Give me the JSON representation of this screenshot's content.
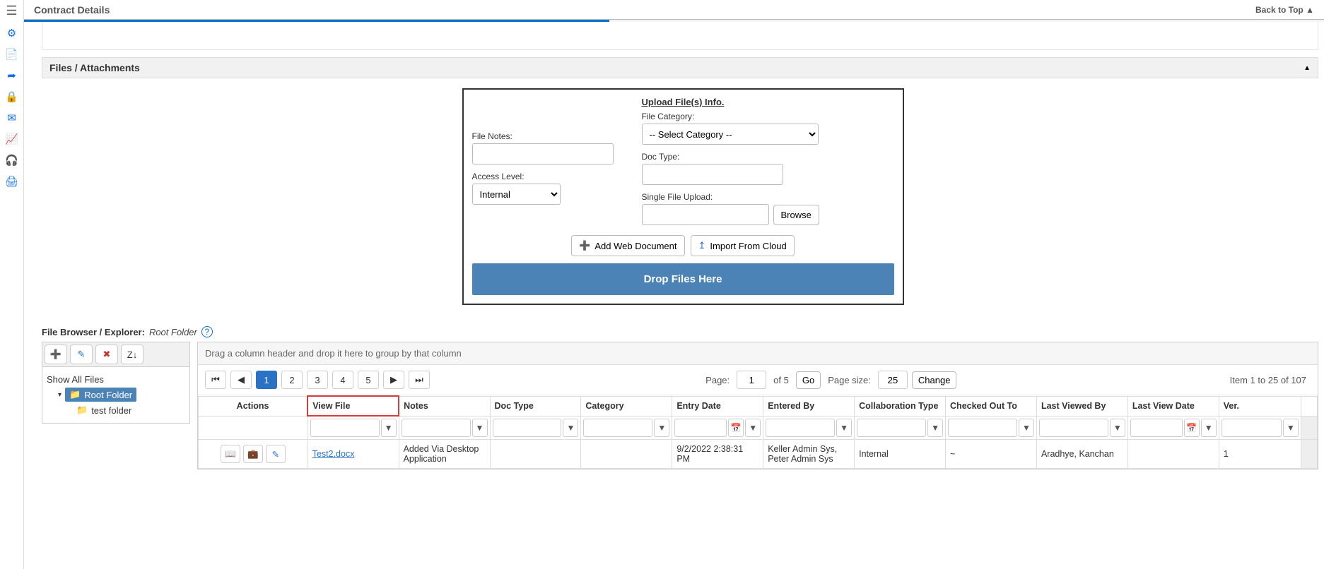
{
  "header": {
    "title": "Contract Details",
    "back_to_top": "Back to Top"
  },
  "section": {
    "files_attachments": "Files / Attachments"
  },
  "upload": {
    "title": "Upload File(s) Info.",
    "file_notes_label": "File Notes:",
    "access_level_label": "Access Level:",
    "access_level_value": "Internal",
    "file_category_label": "File Category:",
    "file_category_value": "-- Select Category --",
    "doc_type_label": "Doc Type:",
    "single_file_label": "Single File Upload:",
    "browse": "Browse",
    "add_web_doc": "Add Web Document",
    "import_cloud": "Import From Cloud",
    "drop_here": "Drop Files Here"
  },
  "browser": {
    "label": "File Browser / Explorer:",
    "path": "Root Folder",
    "show_all": "Show All Files",
    "root": "Root Folder",
    "child1": "test folder"
  },
  "grid": {
    "group_hint": "Drag a column header and drop it here to group by that column",
    "page_label": "Page:",
    "page_value": "1",
    "page_of": "of 5",
    "go": "Go",
    "pagesize_label": "Page size:",
    "pagesize_value": "25",
    "change": "Change",
    "items_text": "Item 1 to 25 of 107",
    "pages": [
      "1",
      "2",
      "3",
      "4",
      "5"
    ],
    "columns": {
      "actions": "Actions",
      "view_file": "View File",
      "notes": "Notes",
      "doc_type": "Doc Type",
      "category": "Category",
      "entry_date": "Entry Date",
      "entered_by": "Entered By",
      "collab_type": "Collaboration Type",
      "checked_out": "Checked Out To",
      "last_viewed_by": "Last Viewed By",
      "last_view_date": "Last View Date",
      "ver": "Ver."
    },
    "rows": [
      {
        "file": "Test2.docx",
        "notes": "Added Via Desktop Application",
        "doc_type": "",
        "category": "",
        "entry_date": "9/2/2022 2:38:31 PM",
        "entered_by": "Keller Admin Sys, Peter Admin Sys",
        "collab_type": "Internal",
        "checked_out": "~",
        "last_viewed_by": "Aradhye, Kanchan",
        "last_view_date": "",
        "ver": "1"
      }
    ]
  }
}
